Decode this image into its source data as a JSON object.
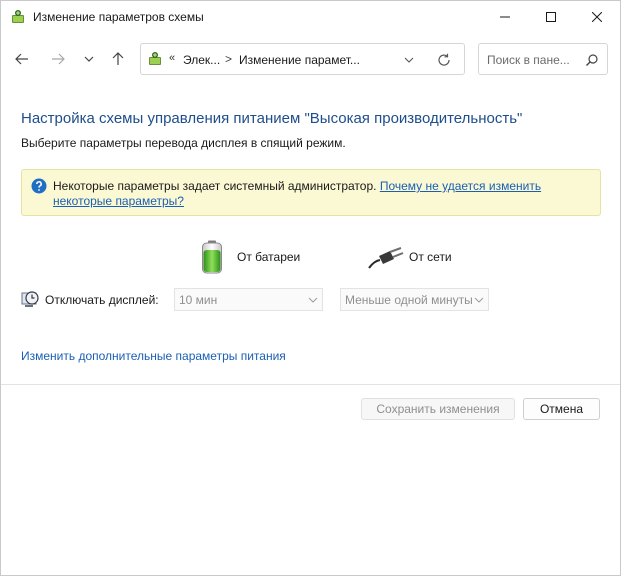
{
  "window": {
    "title": "Изменение параметров схемы"
  },
  "nav": {
    "address_chevron": "«",
    "address_segment_1": "Элек...",
    "address_separator": ">",
    "address_segment_2": "Изменение парамет...",
    "search_placeholder": "Поиск в пане..."
  },
  "main": {
    "heading": "Настройка схемы управления питанием \"Высокая производительность\"",
    "subheading": "Выберите параметры перевода дисплея в спящий режим.",
    "info": {
      "text": "Некоторые параметры задает системный администратор. ",
      "link": "Почему не удается изменить некоторые параметры?"
    },
    "columns": {
      "battery_label": "От батареи",
      "ac_label": "От сети"
    },
    "display_row": {
      "label": "Отключать дисплей:",
      "battery_value": "10 мин",
      "ac_value": "Меньше одной минуты"
    },
    "advanced_link": "Изменить дополнительные параметры питания"
  },
  "buttons": {
    "save": "Сохранить изменения",
    "cancel": "Отмена"
  },
  "colors": {
    "heading": "#1e4e8c",
    "link": "#1a5fb4",
    "info_background": "#fbf8d4",
    "disabled_text": "#8f8f8f"
  }
}
